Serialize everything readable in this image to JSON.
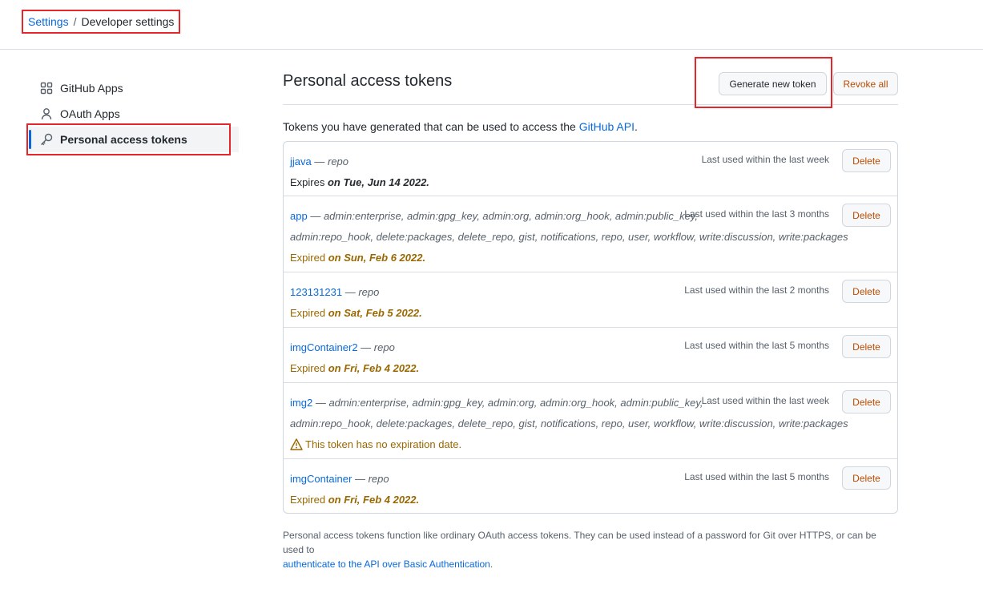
{
  "breadcrumb": {
    "root": "Settings",
    "separator": "/",
    "current": "Developer settings"
  },
  "sidebar": {
    "items": [
      {
        "label": "GitHub Apps",
        "icon": "apps-icon"
      },
      {
        "label": "OAuth Apps",
        "icon": "person-icon"
      },
      {
        "label": "Personal access tokens",
        "icon": "key-icon",
        "active": true
      }
    ]
  },
  "page": {
    "title": "Personal access tokens",
    "generate_label": "Generate new token",
    "revoke_label": "Revoke all",
    "intro_prefix": "Tokens you have generated that can be used to access the ",
    "intro_link": "GitHub API",
    "intro_suffix": "."
  },
  "tokens": [
    {
      "name": "jjava",
      "scopes": "repo",
      "scopes2": "",
      "last_used": "Last used within the last week",
      "exp_prefix": "Expires",
      "exp_date": "on Tue, Jun 14 2022.",
      "status": "active"
    },
    {
      "name": "app",
      "scopes": "admin:enterprise, admin:gpg_key, admin:org, admin:org_hook, admin:public_key,",
      "scopes2": "admin:repo_hook, delete:packages, delete_repo, gist, notifications, repo, user, workflow, write:discussion, write:packages",
      "last_used": "Last used within the last 3 months",
      "exp_prefix": "Expired",
      "exp_date": "on Sun, Feb 6 2022.",
      "status": "expired"
    },
    {
      "name": "123131231",
      "scopes": "repo",
      "scopes2": "",
      "last_used": "Last used within the last 2 months",
      "exp_prefix": "Expired",
      "exp_date": "on Sat, Feb 5 2022.",
      "status": "expired"
    },
    {
      "name": "imgContainer2",
      "scopes": "repo",
      "scopes2": "",
      "last_used": "Last used within the last 5 months",
      "exp_prefix": "Expired",
      "exp_date": "on Fri, Feb 4 2022.",
      "status": "expired"
    },
    {
      "name": "img2",
      "scopes": "admin:enterprise, admin:gpg_key, admin:org, admin:org_hook, admin:public_key,",
      "scopes2": "admin:repo_hook, delete:packages, delete_repo, gist, notifications, repo, user, workflow, write:discussion, write:packages",
      "last_used": "Last used within the last week",
      "warning": "This token has no expiration date.",
      "status": "no-expiry"
    },
    {
      "name": "imgContainer",
      "scopes": "repo",
      "scopes2": "",
      "last_used": "Last used within the last 5 months",
      "exp_prefix": "Expired",
      "exp_date": "on Fri, Feb 4 2022.",
      "status": "expired"
    }
  ],
  "delete_label": "Delete",
  "scope_sep": "—",
  "footer": {
    "text": "Personal access tokens function like ordinary OAuth access tokens. They can be used instead of a password for Git over HTTPS, or can be used to",
    "link": "authenticate to the API over Basic Authentication",
    "suffix": "."
  },
  "colors": {
    "link": "#0969da",
    "danger": "#bc4c00",
    "expired": "#9a6700",
    "highlight": "#e5262b"
  }
}
